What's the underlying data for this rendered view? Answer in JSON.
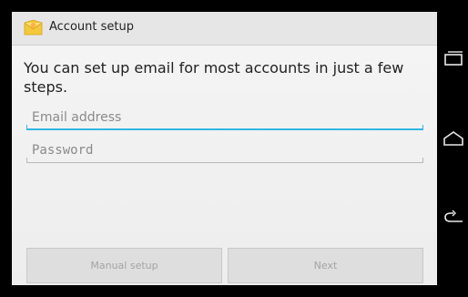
{
  "actionbar": {
    "title": "Account setup",
    "icon": "email-app-icon"
  },
  "main": {
    "intro_text": "You can set up email for most accounts in just a few steps.",
    "email": {
      "placeholder": "Email address",
      "value": ""
    },
    "password": {
      "placeholder": "Password",
      "value": ""
    }
  },
  "buttons": {
    "manual_setup": "Manual setup",
    "next": "Next"
  },
  "navbar": {
    "icons": [
      "recent-apps-icon",
      "home-icon",
      "back-icon"
    ]
  },
  "colors": {
    "accent": "#33b5e5",
    "background": "#f2f2f2",
    "navbar": "#000000",
    "button_bg": "#dedede",
    "disabled_text": "#a4a4a4"
  }
}
